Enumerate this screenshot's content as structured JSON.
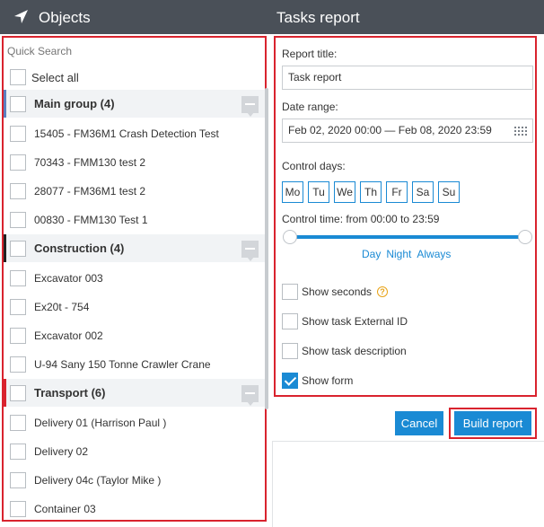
{
  "header": {
    "left_title": "Objects",
    "right_title": "Tasks report",
    "left_icon": "navigation-arrow-icon"
  },
  "objects": {
    "search_placeholder": "Quick Search",
    "select_all_label": "Select all",
    "groups": [
      {
        "label": "Main group (4)",
        "marker_color": "#5b7fbf",
        "items": [
          "15405 - FM36M1 Crash Detection Test",
          "70343 - FMM130 test 2",
          "28077 - FM36M1 test 2",
          "00830 - FMM130 Test 1"
        ]
      },
      {
        "label": "Construction (4)",
        "marker_color": "#222222",
        "items": [
          "Excavator 003",
          "Ex20t - 754",
          "Excavator 002",
          "U-94 Sany 150 Tonne Crawler Crane"
        ]
      },
      {
        "label": "Transport (6)",
        "marker_color": "#d9232e",
        "items": [
          "Delivery 01 (Harrison Paul )",
          "Delivery 02",
          "Delivery 04c (Taylor Mike )",
          "Container 03"
        ]
      }
    ]
  },
  "report": {
    "title_label": "Report title:",
    "title_value": "Task report",
    "date_label": "Date range:",
    "date_value": "Feb 02, 2020 00:00 — Feb 08, 2020 23:59",
    "control_days_label": "Control days:",
    "days": [
      "Mo",
      "Tu",
      "We",
      "Th",
      "Fr",
      "Sa",
      "Su"
    ],
    "control_time_label": "Control time: from 00:00 to 23:59",
    "presets": [
      "Day",
      "Night",
      "Always"
    ],
    "options": [
      {
        "label": "Show seconds",
        "checked": false,
        "help": true
      },
      {
        "label": "Show task External ID",
        "checked": false,
        "help": false
      },
      {
        "label": "Show task description",
        "checked": false,
        "help": false
      },
      {
        "label": "Show form",
        "checked": true,
        "help": false
      }
    ],
    "help_symbol": "?"
  },
  "buttons": {
    "cancel_label": "Cancel",
    "build_label": "Build report"
  },
  "colors": {
    "accent": "#1a8ad4",
    "highlight": "#d9232e",
    "header_bg": "#4a5058"
  }
}
